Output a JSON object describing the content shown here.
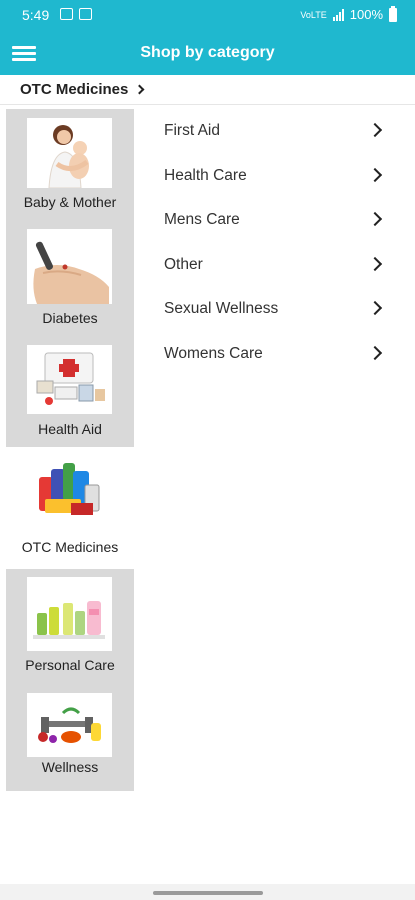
{
  "status": {
    "time": "5:49",
    "battery": "100%",
    "network": "VoLTE"
  },
  "appbar": {
    "title": "Shop by category"
  },
  "breadcrumb": {
    "label": "OTC Medicines"
  },
  "categories": [
    {
      "label": "Baby & Mother",
      "selected": false
    },
    {
      "label": "Diabetes",
      "selected": false
    },
    {
      "label": "Health Aid",
      "selected": false
    },
    {
      "label": "OTC Medicines",
      "selected": true
    },
    {
      "label": "Personal Care",
      "selected": false
    },
    {
      "label": "Wellness",
      "selected": false
    }
  ],
  "subcategories": [
    {
      "label": "First Aid"
    },
    {
      "label": "Health Care"
    },
    {
      "label": "Mens Care"
    },
    {
      "label": "Other"
    },
    {
      "label": "Sexual Wellness"
    },
    {
      "label": "Womens Care"
    }
  ],
  "colors": {
    "accent": "#1fb8cf",
    "sidebar_bg": "#d9d9d9",
    "text": "#222222"
  }
}
